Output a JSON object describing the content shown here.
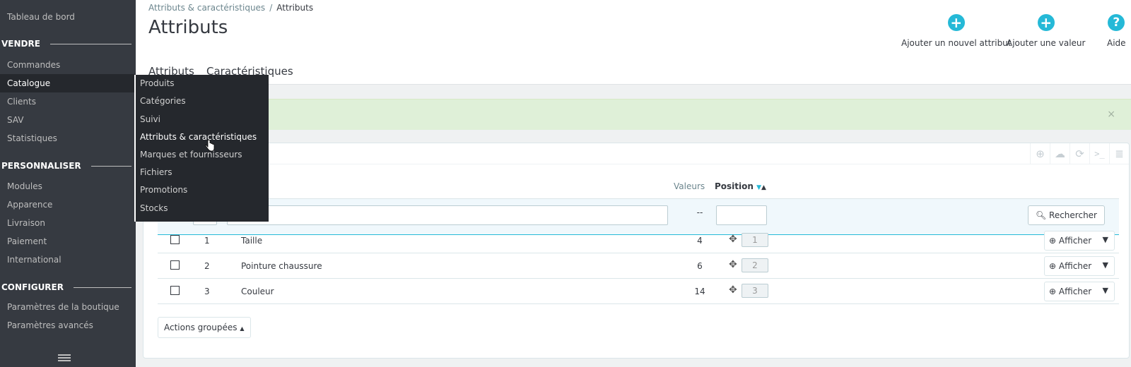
{
  "sidebar": {
    "dashboard": "Tableau de bord",
    "sections": {
      "sell": "VENDRE",
      "customize": "PERSONNALISER",
      "configure": "CONFIGURER"
    },
    "items": {
      "orders": "Commandes",
      "catalog": "Catalogue",
      "customers": "Clients",
      "support": "SAV",
      "stats": "Statistiques",
      "modules": "Modules",
      "appearance": "Apparence",
      "shipping": "Livraison",
      "payment": "Paiement",
      "international": "International",
      "shop_params": "Paramètres de la boutique",
      "advanced_params": "Paramètres avancés"
    }
  },
  "submenu": [
    "Produits",
    "Catégories",
    "Suivi",
    "Attributs & caractéristiques",
    "Marques et fournisseurs",
    "Fichiers",
    "Promotions",
    "Stocks"
  ],
  "header": {
    "breadcrumb_parent": "Attributs & caractéristiques",
    "breadcrumb_sep": "/",
    "breadcrumb_current": "Attributs",
    "title": "Attributs",
    "toolbar": {
      "add_attribute": "Ajouter un nouvel attribut",
      "add_value": "Ajouter une valeur",
      "help": "Aide"
    },
    "tabs": [
      "Attributs",
      "Caractéristiques"
    ]
  },
  "alert": {
    "close": "×"
  },
  "table": {
    "headers": {
      "values": "Valeurs",
      "position": "Position"
    },
    "filter_values_placeholder": "--",
    "search_label": "Rechercher",
    "rows": [
      {
        "id": "1",
        "name": "Taille",
        "values": "4",
        "position": "1",
        "action": "Afficher"
      },
      {
        "id": "2",
        "name": "Pointure chaussure",
        "values": "6",
        "position": "2",
        "action": "Afficher"
      },
      {
        "id": "3",
        "name": "Couleur",
        "values": "14",
        "position": "3",
        "action": "Afficher"
      }
    ],
    "bulk_actions": "Actions groupées"
  },
  "colors": {
    "sidebar_bg": "#363a41",
    "accent": "#25b9d7",
    "alert_bg": "#dff0d8"
  }
}
